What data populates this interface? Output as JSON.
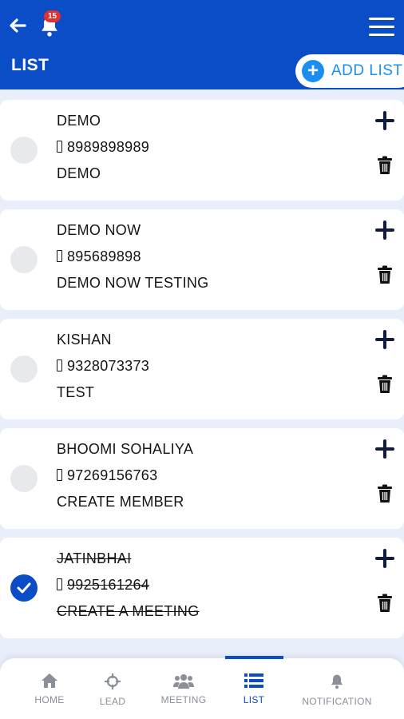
{
  "header": {
    "notification_count": "15",
    "title": "LIST",
    "add_button_label": "ADD LIST"
  },
  "colors": {
    "primary": "#0a4dc6",
    "accent": "#1a8ff0",
    "badge": "#e0302f"
  },
  "items": [
    {
      "name": "DEMO",
      "phone": "8989898989",
      "note": "DEMO",
      "completed": false
    },
    {
      "name": "DEMO NOW",
      "phone": "895689898",
      "note": "DEMO NOW TESTING",
      "completed": false
    },
    {
      "name": "KISHAN",
      "phone": "9328073373",
      "note": "TEST",
      "completed": false
    },
    {
      "name": "BHOOMI SOHALIYA",
      "phone": "97269156763",
      "note": "CREATE MEMBER",
      "completed": false
    },
    {
      "name": "JATINBHAI",
      "phone": "9925161264",
      "note": "CREATE A MEETING",
      "completed": true
    }
  ],
  "nav": [
    {
      "label": "HOME",
      "icon": "home-icon",
      "active": false
    },
    {
      "label": "LEAD",
      "icon": "crosshair-icon",
      "active": false
    },
    {
      "label": "MEETING",
      "icon": "group-icon",
      "active": false
    },
    {
      "label": "LIST",
      "icon": "list-icon",
      "active": true
    },
    {
      "label": "NOTIFICATION",
      "icon": "bell-icon",
      "active": false
    }
  ]
}
